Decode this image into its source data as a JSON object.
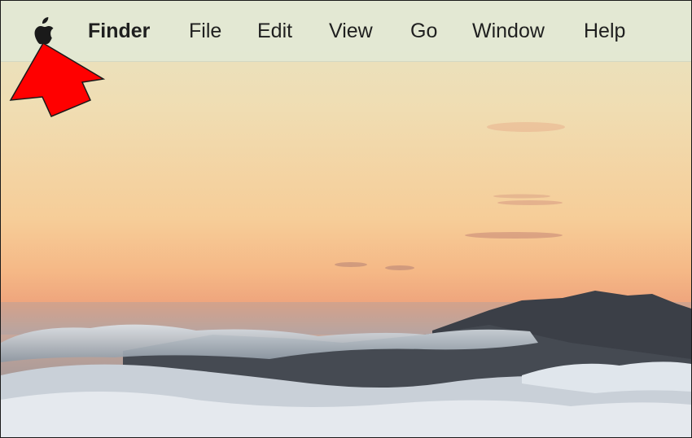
{
  "menubar": {
    "apple_icon": "apple-logo-icon",
    "items": [
      {
        "label": "Finder",
        "bold": true
      },
      {
        "label": "File"
      },
      {
        "label": "Edit"
      },
      {
        "label": "View"
      },
      {
        "label": "Go"
      },
      {
        "label": "Window"
      },
      {
        "label": "Help"
      }
    ]
  },
  "annotation": {
    "icon": "red-arrow-icon",
    "color": "#ff0000",
    "points_to": "apple-menu"
  },
  "wallpaper": {
    "description_icon": "sunset-mountains-wallpaper",
    "sky_top_color": "#e8e3c0",
    "sky_horizon_color": "#f2a878"
  }
}
